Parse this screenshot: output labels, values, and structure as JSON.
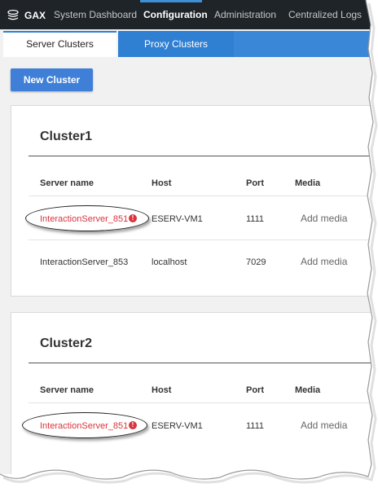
{
  "nav": {
    "brand": "GAX",
    "items": [
      {
        "label": "System Dashboard",
        "active": false
      },
      {
        "label": "Configuration",
        "active": true
      },
      {
        "label": "Administration",
        "active": false
      },
      {
        "label": "Centralized Logs",
        "active": false
      }
    ]
  },
  "tabs": [
    {
      "label": "Server Clusters",
      "selected": true
    },
    {
      "label": "Proxy Clusters",
      "selected": false
    }
  ],
  "new_cluster_button": "New Cluster",
  "columns": [
    "Server name",
    "Host",
    "Port",
    "Media"
  ],
  "clusters": [
    {
      "title": "Cluster1",
      "rows": [
        {
          "server": "InteractionServer_851",
          "host": "ESERV-VM1",
          "port": "1111",
          "media": "Add media",
          "error": true
        },
        {
          "server": "InteractionServer_853",
          "host": "localhost",
          "port": "7029",
          "media": "Add media",
          "error": false
        }
      ]
    },
    {
      "title": "Cluster2",
      "rows": [
        {
          "server": "InteractionServer_851",
          "host": "ESERV-VM1",
          "port": "1111",
          "media": "Add media",
          "error": true
        }
      ]
    }
  ],
  "colors": {
    "accent": "#2f7fd3",
    "error": "#d9343d",
    "nav_bg": "#1f2428"
  },
  "icons": {
    "brand": "layers-icon",
    "error": "exclamation-circle-icon"
  }
}
